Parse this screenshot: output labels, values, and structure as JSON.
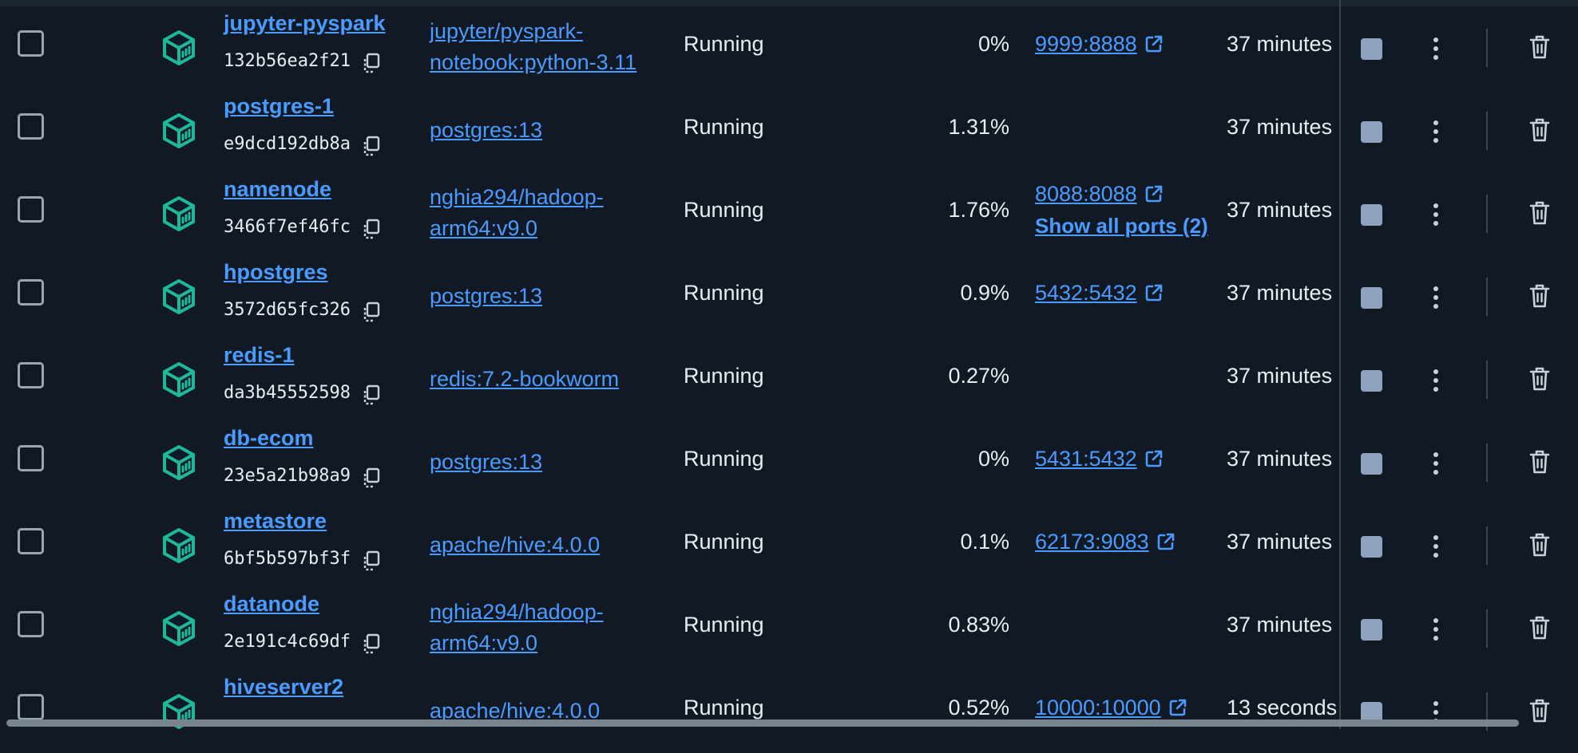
{
  "colors": {
    "link": "#4b9bff",
    "icon_teal": "#20b89a",
    "stop": "#8ea3bb"
  },
  "icons": {
    "container": "container-cube-icon",
    "copy": "copy-icon",
    "external": "external-link-icon",
    "stop": "stop-icon",
    "menu": "kebab-menu-icon",
    "delete": "trash-icon"
  },
  "rows": [
    {
      "name": "jupyter-pyspark",
      "id": "132b56ea2f21",
      "image": [
        "jupyter/pyspark-",
        "notebook:python-3.11"
      ],
      "status": "Running",
      "cpu": "0%",
      "ports": [
        "9999:8888"
      ],
      "show_all": "",
      "started": "37 minutes"
    },
    {
      "name": "postgres-1",
      "id": "e9dcd192db8a",
      "image": [
        "postgres:13"
      ],
      "status": "Running",
      "cpu": "1.31%",
      "ports": [],
      "show_all": "",
      "started": "37 minutes"
    },
    {
      "name": "namenode",
      "id": "3466f7ef46fc",
      "image": [
        "nghia294/hadoop-",
        "arm64:v9.0"
      ],
      "status": "Running",
      "cpu": "1.76%",
      "ports": [
        "8088:8088"
      ],
      "show_all": "Show all ports (2)",
      "started": "37 minutes"
    },
    {
      "name": "hpostgres",
      "id": "3572d65fc326",
      "image": [
        "postgres:13"
      ],
      "status": "Running",
      "cpu": "0.9%",
      "ports": [
        "5432:5432"
      ],
      "show_all": "",
      "started": "37 minutes"
    },
    {
      "name": "redis-1",
      "id": "da3b45552598",
      "image": [
        "redis:7.2-bookworm"
      ],
      "status": "Running",
      "cpu": "0.27%",
      "ports": [],
      "show_all": "",
      "started": "37 minutes"
    },
    {
      "name": "db-ecom",
      "id": "23e5a21b98a9",
      "image": [
        "postgres:13"
      ],
      "status": "Running",
      "cpu": "0%",
      "ports": [
        "5431:5432"
      ],
      "show_all": "",
      "started": "37 minutes"
    },
    {
      "name": "metastore",
      "id": "6bf5b597bf3f",
      "image": [
        "apache/hive:4.0.0"
      ],
      "status": "Running",
      "cpu": "0.1%",
      "ports": [
        "62173:9083"
      ],
      "show_all": "",
      "started": "37 minutes"
    },
    {
      "name": "datanode",
      "id": "2e191c4c69df",
      "image": [
        "nghia294/hadoop-",
        "arm64:v9.0"
      ],
      "status": "Running",
      "cpu": "0.83%",
      "ports": [],
      "show_all": "",
      "started": "37 minutes"
    },
    {
      "name": "hiveserver2",
      "id": "",
      "image": [
        "apache/hive:4.0.0"
      ],
      "status": "Running",
      "cpu": "0.52%",
      "ports": [
        "10000:10000"
      ],
      "show_all": "",
      "started": "13 seconds"
    }
  ]
}
